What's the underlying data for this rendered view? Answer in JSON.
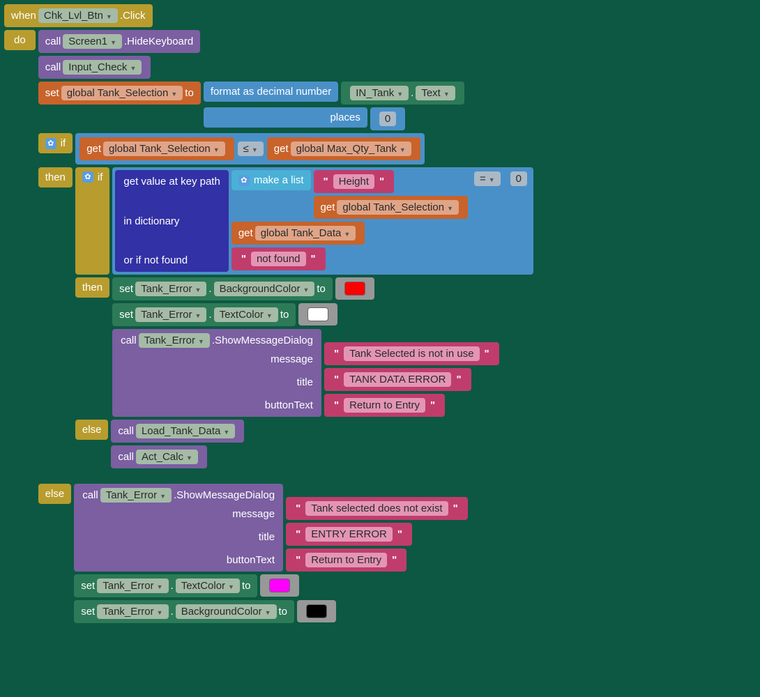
{
  "w": {
    "when": "when",
    "click": ".Click",
    "chk": "Chk_Lvl_Btn"
  },
  "do": "do",
  "call": "call",
  "screen": "Screen1",
  "hk": ".HideKeyboard",
  "ic": "Input_Check",
  "set": "set",
  "to": "to",
  "gts": "global Tank_Selection",
  "fmt": "format as decimal number",
  "places": "places",
  "intank": "IN_Tank",
  "text": "Text",
  "zero": "0",
  "if": "if",
  "then": "then",
  "else": "else",
  "get": "get",
  "gmax": "global Max_Qty_Tank",
  "lte": "≤",
  "gvkp": "get value at key path",
  "mal": "make a list",
  "height": "Height",
  "eq": "=",
  "indict": "in dictionary",
  "gtd": "global Tank_Data",
  "oinf": "or if not found",
  "nf": "not found",
  "te": "Tank_Error",
  "bgc": "BackgroundColor",
  "tc": "TextColor",
  "smd": ".ShowMessageDialog",
  "msg": "message",
  "title": "title",
  "btn": "buttonText",
  "m1": "Tank Selected is not in use",
  "t1": "TANK DATA ERROR",
  "b1": "Return to Entry",
  "ltd": "Load_Tank_Data",
  "ac": "Act_Calc",
  "m2": "Tank selected does not exist",
  "t2": "ENTRY ERROR",
  "b2": "Return to Entry"
}
